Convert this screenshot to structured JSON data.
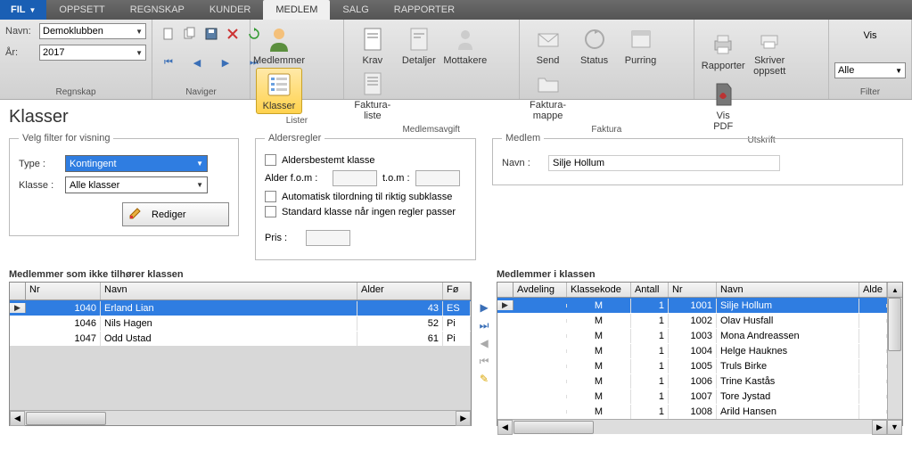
{
  "menu": {
    "fil": "FIL",
    "tabs": [
      "OPPSETT",
      "REGNSKAP",
      "KUNDER",
      "MEDLEM",
      "SALG",
      "RAPPORTER"
    ],
    "active": 3
  },
  "ribbon": {
    "regnskap": {
      "navn_label": "Navn:",
      "navn_value": "Demoklubben",
      "ar_label": "År:",
      "ar_value": "2017",
      "group": "Regnskap"
    },
    "naviger": {
      "group": "Naviger"
    },
    "lister": {
      "medlemmer": "Medlemmer",
      "klasser": "Klasser",
      "group": "Lister"
    },
    "medlemsavgift": {
      "krav": "Krav",
      "detaljer": "Detaljer",
      "mottakere": "Mottakere",
      "fakturaliste": "Faktura-\nliste",
      "group": "Medlemsavgift"
    },
    "faktura": {
      "send": "Send",
      "status": "Status",
      "purring": "Purring",
      "fakturamappe": "Faktura-\nmappe",
      "group": "Faktura"
    },
    "utskrift": {
      "rapporter": "Rapporter",
      "skriveroppsett": "Skriver\noppsett",
      "vispdf": "Vis\nPDF",
      "group": "Utskrift"
    },
    "filter": {
      "vis_label": "Vis",
      "vis_value": "Alle",
      "group": "Filter"
    }
  },
  "page_title": "Klasser",
  "filter_box": {
    "legend": "Velg filter for visning",
    "type_label": "Type :",
    "type_value": "Kontingent",
    "klasse_label": "Klasse :",
    "klasse_value": "Alle klasser",
    "rediger": "Rediger"
  },
  "alders_box": {
    "legend": "Aldersregler",
    "aldersbestemt": "Aldersbestemt klasse",
    "alder_fom": "Alder f.o.m :",
    "tom": "t.o.m :",
    "auto": "Automatisk tilordning til riktig subklasse",
    "standard": "Standard klasse når ingen regler passer",
    "pris": "Pris :"
  },
  "medlem_box": {
    "legend": "Medlem",
    "navn_label": "Navn :",
    "navn_value": "Silje Hollum"
  },
  "left_grid": {
    "title": "Medlemmer som ikke tilhører klassen",
    "cols": [
      "Nr",
      "Navn",
      "Alder",
      "Fø"
    ],
    "rows": [
      {
        "nr": "1040",
        "navn": "Erland Lian",
        "alder": "43",
        "f": "ES"
      },
      {
        "nr": "1046",
        "navn": "Nils Hagen",
        "alder": "52",
        "f": "Pi"
      },
      {
        "nr": "1047",
        "navn": "Odd Ustad",
        "alder": "61",
        "f": "Pi"
      }
    ]
  },
  "right_grid": {
    "title": "Medlemmer i klassen",
    "cols": [
      "Avdeling",
      "Klassekode",
      "Antall",
      "Nr",
      "Navn",
      "Alde"
    ],
    "rows": [
      {
        "avd": "",
        "kk": "M",
        "ant": "1",
        "nr": "1001",
        "navn": "Silje Hollum"
      },
      {
        "avd": "",
        "kk": "M",
        "ant": "1",
        "nr": "1002",
        "navn": "Olav Husfall"
      },
      {
        "avd": "",
        "kk": "M",
        "ant": "1",
        "nr": "1003",
        "navn": "Mona Andreassen"
      },
      {
        "avd": "",
        "kk": "M",
        "ant": "1",
        "nr": "1004",
        "navn": "Helge Hauknes"
      },
      {
        "avd": "",
        "kk": "M",
        "ant": "1",
        "nr": "1005",
        "navn": "Truls Birke"
      },
      {
        "avd": "",
        "kk": "M",
        "ant": "1",
        "nr": "1006",
        "navn": "Trine Kastås"
      },
      {
        "avd": "",
        "kk": "M",
        "ant": "1",
        "nr": "1007",
        "navn": "Tore Jystad"
      },
      {
        "avd": "",
        "kk": "M",
        "ant": "1",
        "nr": "1008",
        "navn": "Arild Hansen"
      }
    ]
  }
}
